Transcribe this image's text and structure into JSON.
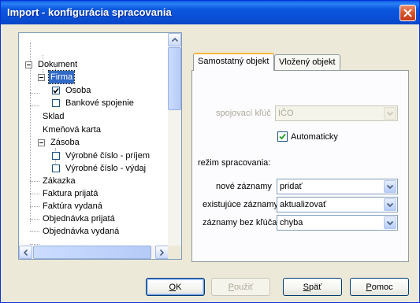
{
  "window": {
    "title": "Import - konfigurácia spracovania",
    "colors": {
      "titlebar": "#0a58df",
      "selection": "#316ac5",
      "active_tab_accent": "#f6b73b"
    }
  },
  "tree": {
    "items": [
      {
        "label": "Dokument",
        "type": "expander"
      },
      {
        "label": "Firma",
        "type": "expander",
        "selected": true
      },
      {
        "label": "Osoba",
        "type": "checkbox",
        "checked": true
      },
      {
        "label": "Bankové spojenie",
        "type": "checkbox",
        "checked": false
      },
      {
        "label": "Sklad",
        "type": "leaf"
      },
      {
        "label": "Kmeňová karta",
        "type": "leaf"
      },
      {
        "label": "Zásoba",
        "type": "expander"
      },
      {
        "label": "Výrobné číslo - príjem",
        "type": "checkbox",
        "checked": false
      },
      {
        "label": "Výrobné číslo - výdaj",
        "type": "checkbox",
        "checked": false
      },
      {
        "label": "Zákazka",
        "type": "leaf"
      },
      {
        "label": "Faktura prijatá",
        "type": "leaf"
      },
      {
        "label": "Faktúra vydaná",
        "type": "leaf"
      },
      {
        "label": "Objednávka prijatá",
        "type": "leaf"
      },
      {
        "label": "Objednávka vydaná",
        "type": "leaf"
      }
    ],
    "icons": {
      "expander": "minus-box-icon",
      "scroll_up": "arrow-up-icon",
      "scroll_left": "arrow-left-icon",
      "scroll_right": "arrow-right-icon"
    }
  },
  "tabs": [
    {
      "label": "Samostatný objekt",
      "active": true
    },
    {
      "label": "Vložený objekt",
      "active": false
    }
  ],
  "panel": {
    "key_label": "spojovací kľúč",
    "key_value": "IČO",
    "auto_checkbox_label": "Automaticky",
    "auto_checked": true,
    "mode_section_label": "režim spracovania:",
    "new_records_label": "nové záznamy",
    "new_records_value": "pridať",
    "existing_records_label": "existujúce záznamy",
    "existing_records_value": "aktualizovať",
    "no_key_label": "záznamy bez kľúča",
    "no_key_value": "chyba"
  },
  "buttons": {
    "ok": {
      "first": "O",
      "rest": "K"
    },
    "apply": {
      "first": "P",
      "rest": "oužiť"
    },
    "back": {
      "first": "S",
      "rest": "päť"
    },
    "help": {
      "first": "P",
      "rest": "omoc"
    }
  }
}
